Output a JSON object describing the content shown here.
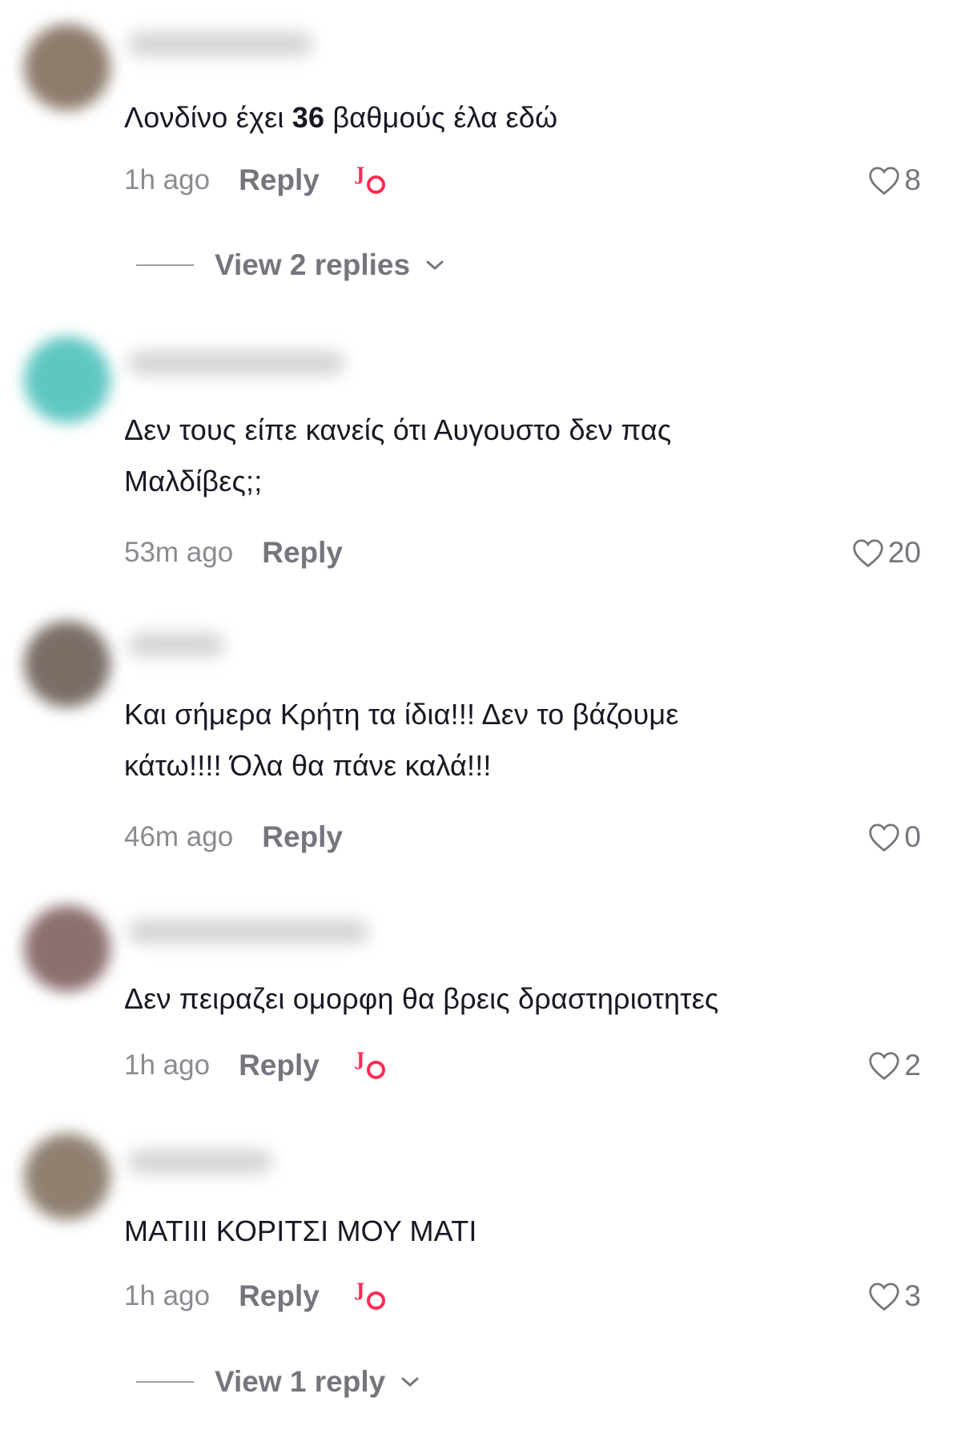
{
  "comments": [
    {
      "avatar_color": "#8e7c6c",
      "text_before": "Λονδίνο έχει ",
      "text_bold": "36",
      "text_after": " βαθμούς έλα εδώ",
      "time": "1h ago",
      "reply_label": "Reply",
      "creator_liked": true,
      "likes": "8",
      "view_replies": "View 2 replies"
    },
    {
      "avatar_color": "#5fc7c2",
      "text": "Δεν τους είπε κανείς ότι Αυγουστο δεν πας\nΜαλδίβες;;",
      "time": "53m ago",
      "reply_label": "Reply",
      "creator_liked": false,
      "likes": "20"
    },
    {
      "avatar_color": "#7a6e67",
      "text": "Και σήμερα Κρήτη τα ίδια!!! Δεν το βάζουμε\nκάτω!!!! Όλα θα πάνε καλά!!!",
      "time": "46m ago",
      "reply_label": "Reply",
      "creator_liked": false,
      "likes": "0"
    },
    {
      "avatar_color": "#8c6f6f",
      "text": "Δεν πειραζει ομορφη θα βρεις δραστηριοτητες",
      "time": "1h ago",
      "reply_label": "Reply",
      "creator_liked": true,
      "likes": "2"
    },
    {
      "avatar_color": "#8f8070",
      "text": "ΜΑΤΙΙΙ ΚΟΡΙΤΣΙ ΜΟΥ ΜΑΤΙ",
      "time": "1h ago",
      "reply_label": "Reply",
      "creator_liked": true,
      "likes": "3",
      "view_replies": "View 1 reply"
    }
  ],
  "icons": {
    "like": "heart-outline-icon",
    "expand": "chevron-down-icon",
    "creator_like": "creator-liked-icon"
  },
  "colors": {
    "accent": "#fe2c55",
    "muted": "#75767d"
  }
}
